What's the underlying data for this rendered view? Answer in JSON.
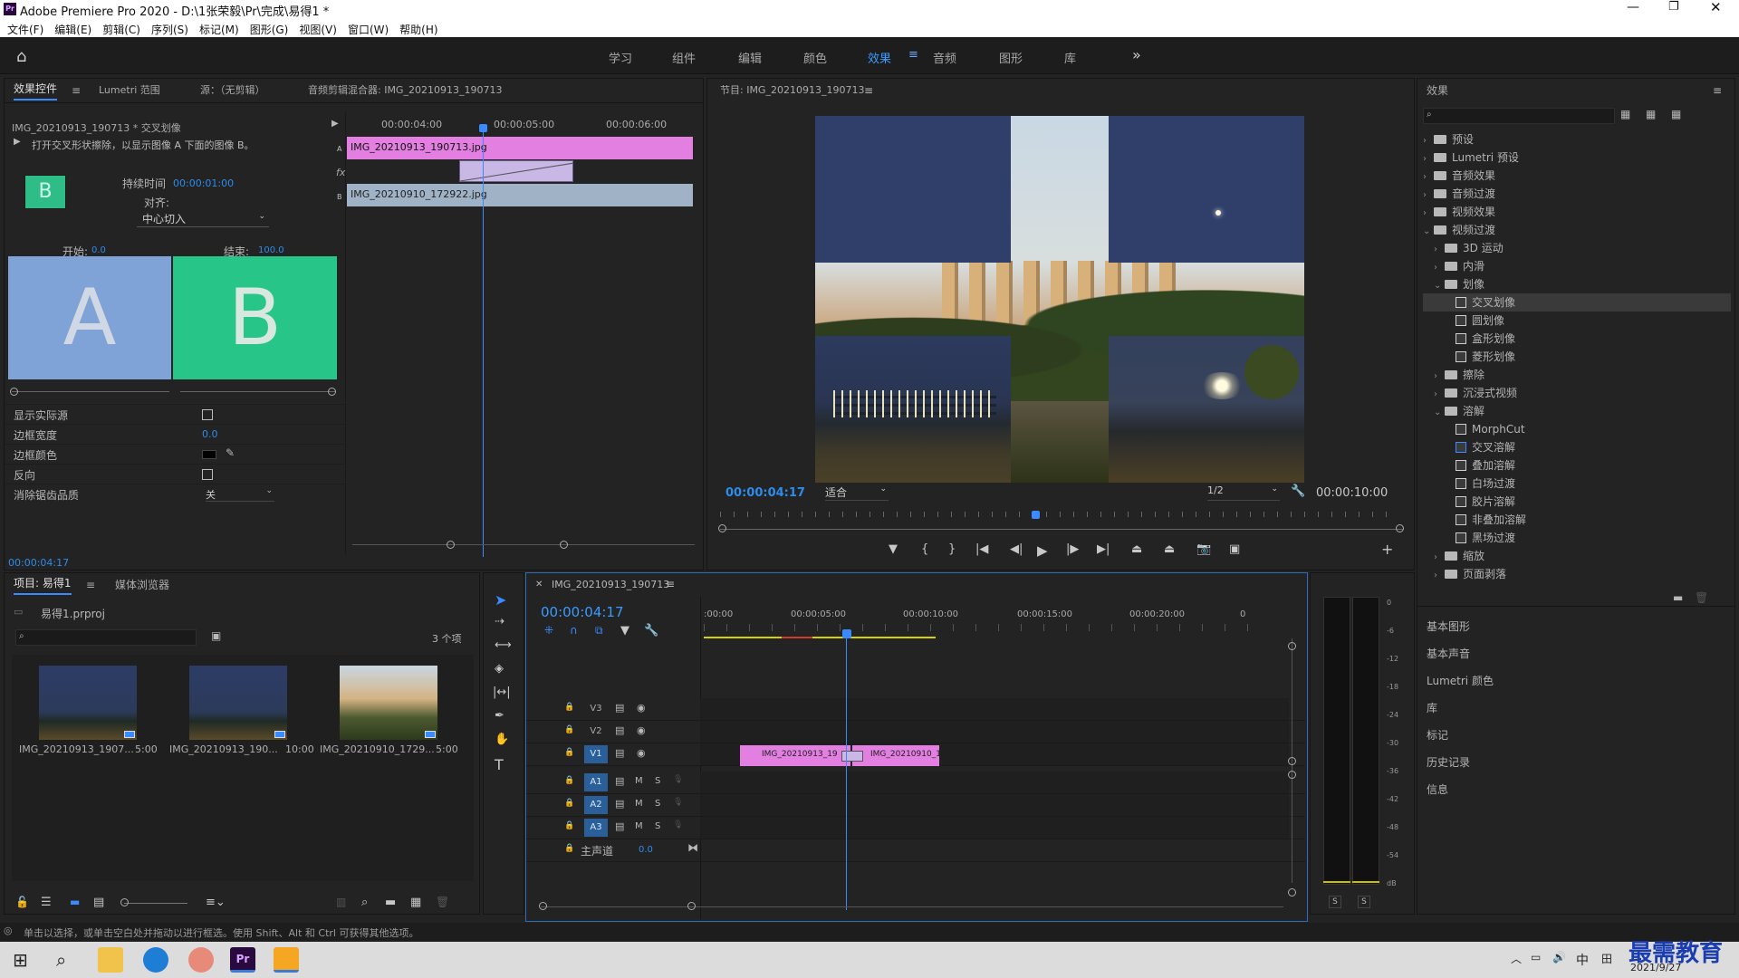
{
  "app": {
    "title": "Adobe Premiere Pro 2020 - D:\\1张荣毅\\Pr\\完成\\易得1 *"
  },
  "menu": [
    "文件(F)",
    "编辑(E)",
    "剪辑(C)",
    "序列(S)",
    "标记(M)",
    "图形(G)",
    "视图(V)",
    "窗口(W)",
    "帮助(H)"
  ],
  "workspaces": [
    "学习",
    "组件",
    "编辑",
    "颜色",
    "效果",
    "音频",
    "图形",
    "库"
  ],
  "effect_controls": {
    "tabs": [
      "效果控件",
      "Lumetri 范围",
      "源：（无剪辑）",
      "音频剪辑混合器: IMG_20210913_190713"
    ],
    "clip_path": "IMG_20210913_190713 * 交叉划像",
    "description": "打开交叉形状擦除，以显示图像 A 下面的图像 B。",
    "duration_label": "持续时间",
    "duration_value": "00:00:01:00",
    "align_label": "对齐:",
    "align_value": "中心切入",
    "start_label": "开始:",
    "start_value": "0.0",
    "end_label": "结束:",
    "end_value": "100.0",
    "a_letter": "A",
    "b_letter": "B",
    "thumb_letter": "B",
    "props": [
      {
        "label": "显示实际源"
      },
      {
        "label": "边框宽度",
        "value": "0.0"
      },
      {
        "label": "边框颜色"
      },
      {
        "label": "反向"
      },
      {
        "label": "消除锯齿品质",
        "value": "关"
      }
    ],
    "mini_times": [
      "00:00:04:00",
      "00:00:05:00",
      "00:00:06:00"
    ],
    "clip_a": "IMG_20210913_190713.jpg",
    "clip_b": "IMG_20210910_172922.jpg",
    "track_a": "A",
    "track_b": "B",
    "fx_label": "fx",
    "timecode": "00:00:04:17"
  },
  "program": {
    "title": "节目: IMG_20210913_190713",
    "timecode": "00:00:04:17",
    "fit": "适合",
    "res": "1/2",
    "duration": "00:00:10:00"
  },
  "effects_panel": {
    "title": "效果",
    "tree": [
      {
        "l": 0,
        "t": "预设",
        "kind": "bin",
        "open": false
      },
      {
        "l": 0,
        "t": "Lumetri 预设",
        "kind": "bin",
        "open": false
      },
      {
        "l": 0,
        "t": "音频效果",
        "kind": "folder",
        "open": false
      },
      {
        "l": 0,
        "t": "音频过渡",
        "kind": "folder",
        "open": false
      },
      {
        "l": 0,
        "t": "视频效果",
        "kind": "folder",
        "open": false
      },
      {
        "l": 0,
        "t": "视频过渡",
        "kind": "folder",
        "open": true
      },
      {
        "l": 1,
        "t": "3D 运动",
        "kind": "folder",
        "open": false
      },
      {
        "l": 1,
        "t": "内滑",
        "kind": "folder",
        "open": false
      },
      {
        "l": 1,
        "t": "划像",
        "kind": "folder",
        "open": true
      },
      {
        "l": 2,
        "t": "交叉划像",
        "kind": "fx",
        "sel": true
      },
      {
        "l": 2,
        "t": "圆划像",
        "kind": "fx"
      },
      {
        "l": 2,
        "t": "盒形划像",
        "kind": "fx"
      },
      {
        "l": 2,
        "t": "菱形划像",
        "kind": "fx"
      },
      {
        "l": 1,
        "t": "擦除",
        "kind": "folder",
        "open": false
      },
      {
        "l": 1,
        "t": "沉浸式视频",
        "kind": "folder",
        "open": false
      },
      {
        "l": 1,
        "t": "溶解",
        "kind": "folder",
        "open": true
      },
      {
        "l": 2,
        "t": "MorphCut",
        "kind": "fx"
      },
      {
        "l": 2,
        "t": "交叉溶解",
        "kind": "fx",
        "def": true
      },
      {
        "l": 2,
        "t": "叠加溶解",
        "kind": "fx"
      },
      {
        "l": 2,
        "t": "白场过渡",
        "kind": "fx"
      },
      {
        "l": 2,
        "t": "胶片溶解",
        "kind": "fx"
      },
      {
        "l": 2,
        "t": "非叠加溶解",
        "kind": "fx"
      },
      {
        "l": 2,
        "t": "黑场过渡",
        "kind": "fx"
      },
      {
        "l": 1,
        "t": "缩放",
        "kind": "folder",
        "open": false
      },
      {
        "l": 1,
        "t": "页面剥落",
        "kind": "folder",
        "open": false
      }
    ],
    "sections": [
      "基本图形",
      "基本声音",
      "Lumetri 颜色",
      "库",
      "标记",
      "历史记录",
      "信息"
    ]
  },
  "project": {
    "tabs": [
      "项目: 易得1",
      "媒体浏览器"
    ],
    "file": "易得1.prproj",
    "count": "3 个项",
    "items": [
      {
        "name": "IMG_20210913_1907...",
        "dur": "5:00"
      },
      {
        "name": "IMG_20210913_190...",
        "dur": "10:00"
      },
      {
        "name": "IMG_20210910_1729...",
        "dur": "5:00"
      }
    ]
  },
  "timeline": {
    "seq": "IMG_20210913_190713",
    "timecode": "00:00:04:17",
    "ruler": [
      ":00:00",
      "00:00:05:00",
      "00:00:10:00",
      "00:00:15:00",
      "00:00:20:00",
      "0"
    ],
    "video_tracks": [
      "V3",
      "V2",
      "V1"
    ],
    "audio_tracks": [
      "A1",
      "A2",
      "A3"
    ],
    "master": "主声道",
    "master_val": "0.0",
    "clip1": "IMG_20210913_19",
    "clip2": "IMG_20210910_172"
  },
  "meter": {
    "scale": [
      "0",
      "-6",
      "-12",
      "-18",
      "-24",
      "-30",
      "-36",
      "-42",
      "-48",
      "-54",
      "dB"
    ],
    "solo": [
      "S",
      "S"
    ]
  },
  "status": "单击以选择，或单击空白处并拖动以进行框选。使用 Shift、Alt 和 Ctrl 可获得其他选项。",
  "taskbar": {
    "time": "",
    "date": "2021/9/27",
    "ime": "中"
  },
  "watermark": "最需教育"
}
